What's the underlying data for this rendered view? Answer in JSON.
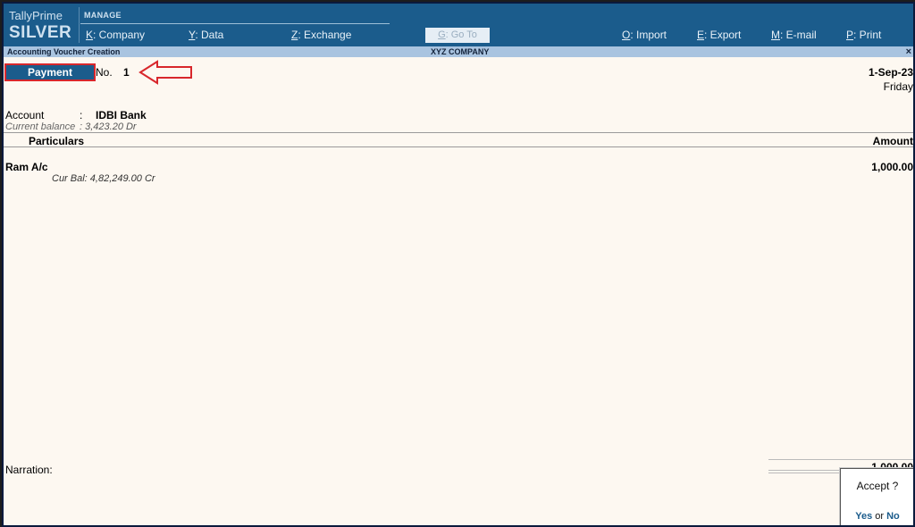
{
  "brand": {
    "product": "TallyPrime",
    "edition": "SILVER"
  },
  "menu": {
    "section": "MANAGE",
    "items": [
      {
        "key": "K",
        "label": ": Company"
      },
      {
        "key": "Y",
        "label": ": Data"
      },
      {
        "key": "Z",
        "label": ": Exchange"
      },
      {
        "key": "G",
        "label": ": Go To"
      },
      {
        "key": "O",
        "label": ": Import"
      },
      {
        "key": "E",
        "label": ": Export"
      },
      {
        "key": "M",
        "label": ": E-mail"
      },
      {
        "key": "P",
        "label": ": Print"
      }
    ]
  },
  "titlebar": {
    "screen": "Accounting Voucher Creation",
    "company": "XYZ COMPANY",
    "close": "×"
  },
  "voucher": {
    "type": "Payment",
    "no_label": "No.",
    "no_value": "1",
    "date": "1-Sep-23",
    "day": "Friday",
    "account_label": "Account",
    "account_colon": ":",
    "account_value": "IDBI Bank",
    "balance_label": "Current balance",
    "balance_value": ": 3,423.20 Dr"
  },
  "columns": {
    "particulars": "Particulars",
    "amount": "Amount"
  },
  "rows": [
    {
      "name": "Ram A/c",
      "amount": "1,000.00",
      "cur_bal": "Cur Bal:  4,82,249.00 Cr"
    }
  ],
  "narration_label": "Narration:",
  "total": "1,000.00",
  "dialog": {
    "question": "Accept ?",
    "yes": "Yes",
    "or": "or",
    "no": "No"
  },
  "colors": {
    "accent": "#1b5c8c",
    "highlight": "#d8272c",
    "background": "#fdf8f1"
  }
}
